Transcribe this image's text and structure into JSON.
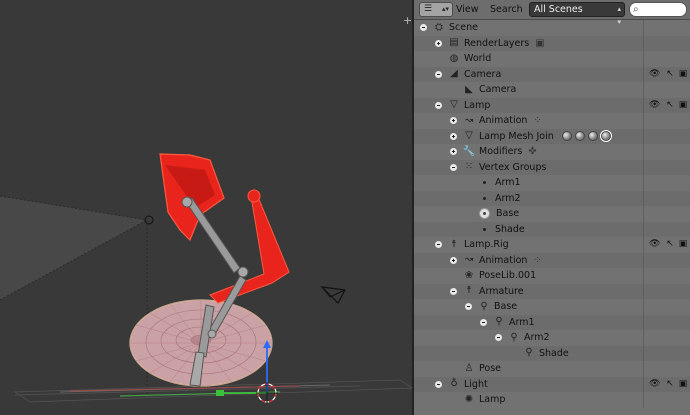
{
  "viewport": {
    "colors": {
      "background": "#393939",
      "lamp_red": "#e8241c",
      "base_pink": "#c9a0a0",
      "grid": "#4b4b4b"
    }
  },
  "outliner": {
    "header": {
      "editor_type_icon": "outliner-icon",
      "menu_view": "View",
      "menu_search": "Search",
      "display_mode": "All Scenes",
      "search_icon": "magnifier-icon",
      "search_value": ""
    },
    "rows": [
      {
        "label": "Scene",
        "indent": 0,
        "expanded": true,
        "icon": "scene-icon",
        "glyph": "⛭"
      },
      {
        "label": "RenderLayers",
        "indent": 1,
        "expanded": false,
        "icon": "render-layers-icon",
        "glyph": "▤",
        "extra_icon": "render-layer-icon"
      },
      {
        "label": "World",
        "indent": 1,
        "leaf": true,
        "icon": "world-icon",
        "glyph": "◍"
      },
      {
        "label": "Camera",
        "indent": 1,
        "expanded": true,
        "icon": "camera-object-icon",
        "glyph": "◢",
        "restrict": true
      },
      {
        "label": "Camera",
        "indent": 2,
        "leaf": true,
        "icon": "camera-data-icon",
        "glyph": "◣"
      },
      {
        "label": "Lamp",
        "indent": 1,
        "expanded": true,
        "icon": "mesh-object-icon",
        "glyph": "▽",
        "restrict": true
      },
      {
        "label": "Animation",
        "indent": 2,
        "expanded": false,
        "icon": "animation-icon",
        "glyph": "↝",
        "extra_icon": "action-icon"
      },
      {
        "label": "Lamp Mesh Join",
        "indent": 2,
        "expanded": false,
        "icon": "mesh-data-icon",
        "glyph": "▽",
        "materials": true
      },
      {
        "label": "Modifiers",
        "indent": 2,
        "expanded": false,
        "icon": "wrench-icon",
        "glyph": "🔧",
        "extra_icon": "armature-modifier-icon"
      },
      {
        "label": "Vertex Groups",
        "indent": 2,
        "expanded": true,
        "icon": "vertex-groups-icon",
        "glyph": "⁙"
      },
      {
        "label": "Arm1",
        "indent": 3,
        "vgroup": true
      },
      {
        "label": "Arm2",
        "indent": 3,
        "vgroup": true
      },
      {
        "label": "Base",
        "indent": 3,
        "vgroup": true,
        "active": true
      },
      {
        "label": "Shade",
        "indent": 3,
        "vgroup": true
      },
      {
        "label": "Lamp.Rig",
        "indent": 1,
        "expanded": true,
        "icon": "armature-object-icon",
        "glyph": "☨",
        "restrict": true
      },
      {
        "label": "Animation",
        "indent": 2,
        "expanded": false,
        "icon": "animation-icon",
        "glyph": "↝",
        "extra_icon": "action-icon"
      },
      {
        "label": "PoseLib.001",
        "indent": 2,
        "leaf": true,
        "icon": "poselib-icon",
        "glyph": "❀"
      },
      {
        "label": "Armature",
        "indent": 2,
        "expanded": true,
        "icon": "armature-data-icon",
        "glyph": "☨"
      },
      {
        "label": "Base",
        "indent": 3,
        "expanded": true,
        "icon": "bone-icon",
        "glyph": "⚲"
      },
      {
        "label": "Arm1",
        "indent": 4,
        "expanded": true,
        "icon": "bone-icon",
        "glyph": "⚲"
      },
      {
        "label": "Arm2",
        "indent": 5,
        "expanded": true,
        "icon": "bone-icon",
        "glyph": "⚲"
      },
      {
        "label": "Shade",
        "indent": 6,
        "leaf": true,
        "icon": "bone-icon",
        "glyph": "⚲"
      },
      {
        "label": "Pose",
        "indent": 2,
        "leaf": true,
        "icon": "pose-icon",
        "glyph": "♙"
      },
      {
        "label": "Light",
        "indent": 1,
        "expanded": true,
        "icon": "lamp-object-icon",
        "glyph": "♁",
        "restrict": true
      },
      {
        "label": "Lamp",
        "indent": 2,
        "leaf": true,
        "icon": "lamp-data-icon",
        "glyph": "✺"
      }
    ],
    "restrict_icons": {
      "eye": "👁",
      "cursor": "↖",
      "camera": "▣"
    }
  }
}
